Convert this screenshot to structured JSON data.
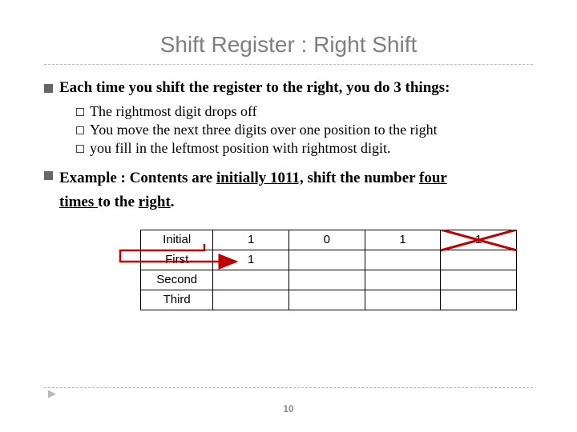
{
  "title": "Shift Register : Right Shift",
  "main_bullet": "Each time you shift the register to the right, you do 3 things:",
  "sub_bullets": [
    "The rightmost digit drops off",
    "You move the next three digits over one position to the right",
    "you fill in the leftmost position with rightmost digit."
  ],
  "example": {
    "prefix": "Example : Contents are ",
    "u1": "initially 1011,",
    "mid": "  shift the number ",
    "u2": "four",
    "line2a": "times ",
    "mid2": "to the ",
    "u3": "right",
    "period": "."
  },
  "table": {
    "rows": [
      "Initial",
      "First",
      "Second",
      "Third"
    ],
    "initial": [
      "1",
      "0",
      "1",
      "1"
    ],
    "first": [
      "1",
      "",
      "",
      ""
    ]
  },
  "page_number": "10"
}
